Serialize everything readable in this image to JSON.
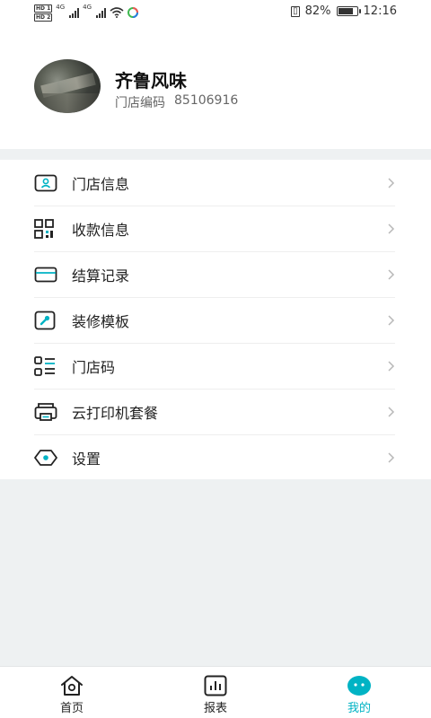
{
  "status_bar": {
    "hd_tags": [
      "HD 1",
      "HD 2"
    ],
    "network": "4G",
    "battery_level": "82%",
    "time": "12:16"
  },
  "profile": {
    "store_name": "齐鲁风味",
    "code_label": "门店编码",
    "code_value": "85106916"
  },
  "menu": {
    "items": [
      {
        "label": "门店信息",
        "icon": "store-info-icon"
      },
      {
        "label": "收款信息",
        "icon": "qr-code-icon"
      },
      {
        "label": "结算记录",
        "icon": "card-icon"
      },
      {
        "label": "装修模板",
        "icon": "wrench-icon"
      },
      {
        "label": "门店码",
        "icon": "store-code-icon"
      },
      {
        "label": "云打印机套餐",
        "icon": "printer-icon"
      },
      {
        "label": "设置",
        "icon": "settings-icon"
      }
    ]
  },
  "bottom_nav": {
    "items": [
      {
        "label": "首页",
        "icon": "home-icon"
      },
      {
        "label": "报表",
        "icon": "report-icon"
      },
      {
        "label": "我的",
        "icon": "profile-icon"
      }
    ],
    "active": "我的"
  },
  "colors": {
    "accent": "#00b3c4",
    "background": "#eef1f2",
    "icon": "#222222",
    "chevron": "#b8b8b8"
  }
}
